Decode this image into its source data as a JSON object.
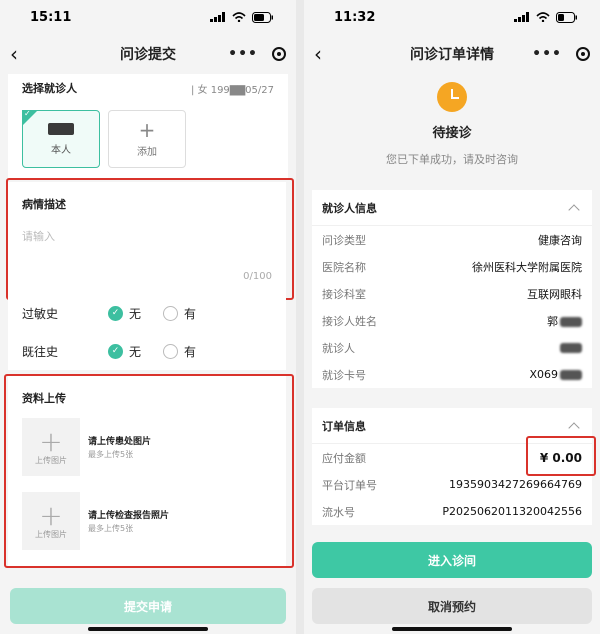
{
  "left": {
    "status_time": "15:11",
    "nav_title": "问诊提交",
    "patient": {
      "title": "选择就诊人",
      "meta": "| 女 199▇▇05/27",
      "self_label": "本人",
      "add_label": "添加"
    },
    "description": {
      "title": "病情描述",
      "placeholder": "请输入",
      "counter": "0/100"
    },
    "allergy": {
      "label": "过敏史",
      "no": "无",
      "yes": "有"
    },
    "history": {
      "label": "既往史",
      "no": "无",
      "yes": "有"
    },
    "upload": {
      "title": "资料上传",
      "box_label": "上传图片",
      "item1_title": "请上传患处图片",
      "item1_sub": "最多上传5张",
      "item2_title": "请上传检查报告照片",
      "item2_sub": "最多上传5张"
    },
    "submit_label": "提交申请"
  },
  "right": {
    "status_time": "11:32",
    "nav_title": "问诊订单详情",
    "status_title": "待接诊",
    "status_sub": "您已下单成功，请及时咨询",
    "patient_info": {
      "title": "就诊人信息",
      "rows": [
        {
          "k": "问诊类型",
          "v": "健康咨询"
        },
        {
          "k": "医院名称",
          "v": "徐州医科大学附属医院"
        },
        {
          "k": "接诊科室",
          "v": "互联网眼科"
        },
        {
          "k": "接诊人姓名",
          "v": "郭"
        },
        {
          "k": "就诊人",
          "v": ""
        },
        {
          "k": "就诊卡号",
          "v": "X069"
        }
      ]
    },
    "order_info": {
      "title": "订单信息",
      "rows": [
        {
          "k": "应付金额",
          "v": "¥ 0.00"
        },
        {
          "k": "平台订单号",
          "v": "1935903427269664769"
        },
        {
          "k": "流水号",
          "v": "P2025062011320042556"
        }
      ]
    },
    "enter_label": "进入诊间",
    "cancel_label": "取消预约"
  },
  "colors": {
    "accent": "#3ec8a4",
    "highlight": "#d9322b",
    "pending": "#f5a623"
  }
}
